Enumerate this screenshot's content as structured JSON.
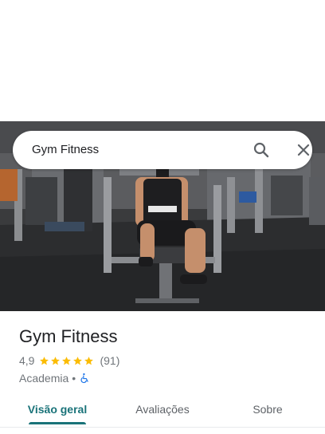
{
  "search": {
    "query": "Gym Fitness"
  },
  "place": {
    "name": "Gym Fitness",
    "rating": "4,9",
    "stars": 5,
    "review_count": "(91)",
    "category": "Academia",
    "separator": "•"
  },
  "icons": {
    "search": "search-icon",
    "close": "close-icon",
    "accessible": "wheelchair-accessible-icon",
    "star": "star-icon"
  },
  "tabs": [
    {
      "label": "Visão geral",
      "active": true
    },
    {
      "label": "Avaliações",
      "active": false
    },
    {
      "label": "Sobre",
      "active": false
    }
  ],
  "colors": {
    "accent": "#1a7379",
    "star": "#fbbc04",
    "accessible": "#1a73e8",
    "secondary_text": "#70757a"
  }
}
